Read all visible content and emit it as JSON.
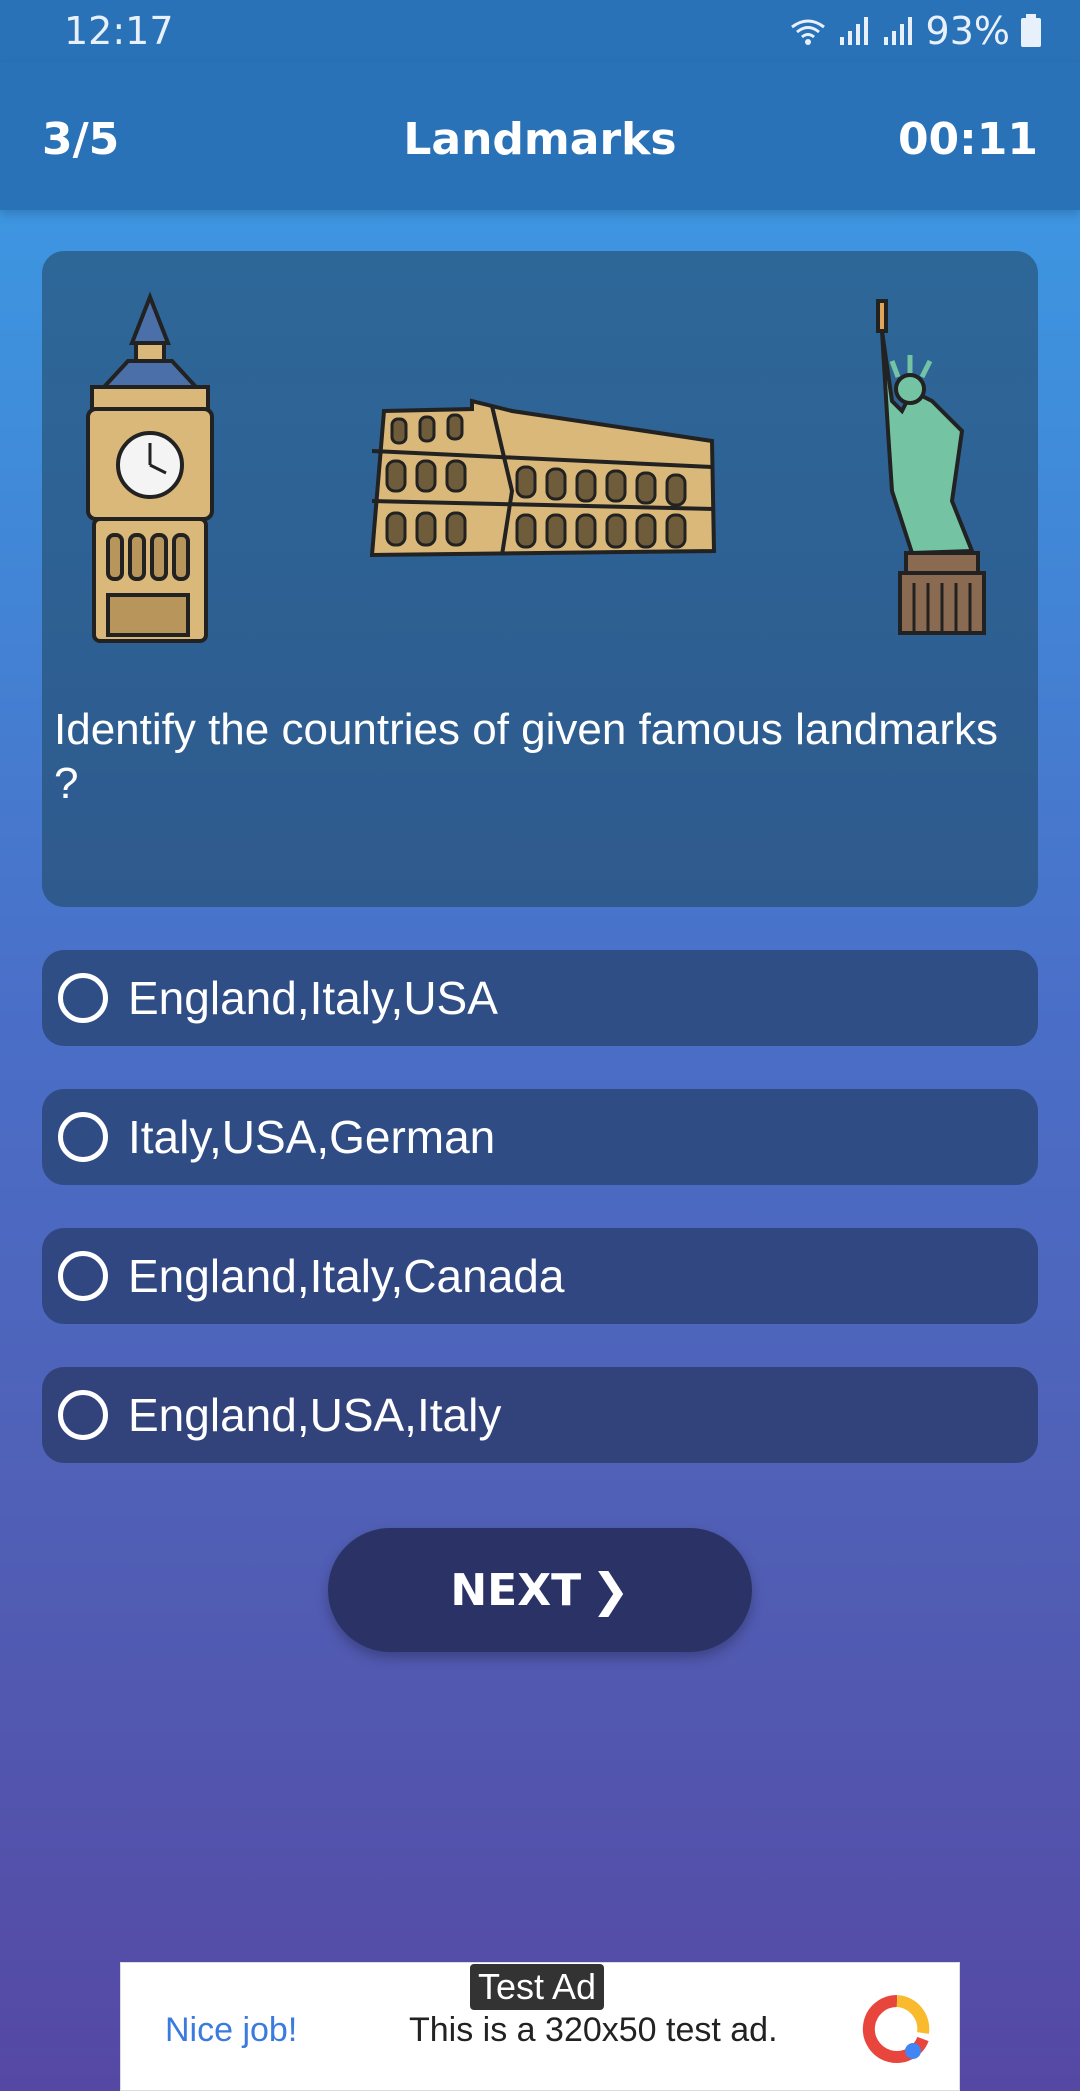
{
  "status_bar": {
    "time": "12:17",
    "battery": "93%"
  },
  "header": {
    "progress": "3/5",
    "title": "Landmarks",
    "timer": "00:11"
  },
  "question": {
    "text": "Identify the countries of given famous landmarks ?",
    "image_items": [
      "big-ben",
      "colosseum",
      "statue-of-liberty"
    ]
  },
  "options": [
    {
      "label": "England,Italy,USA"
    },
    {
      "label": "Italy,USA,German"
    },
    {
      "label": "England,Italy,Canada"
    },
    {
      "label": "England,USA,Italy"
    }
  ],
  "next_button": {
    "label": "NEXT"
  },
  "ad": {
    "tag": "Test Ad",
    "headline": "Nice job!",
    "body": "This is a 320x50 test ad."
  }
}
